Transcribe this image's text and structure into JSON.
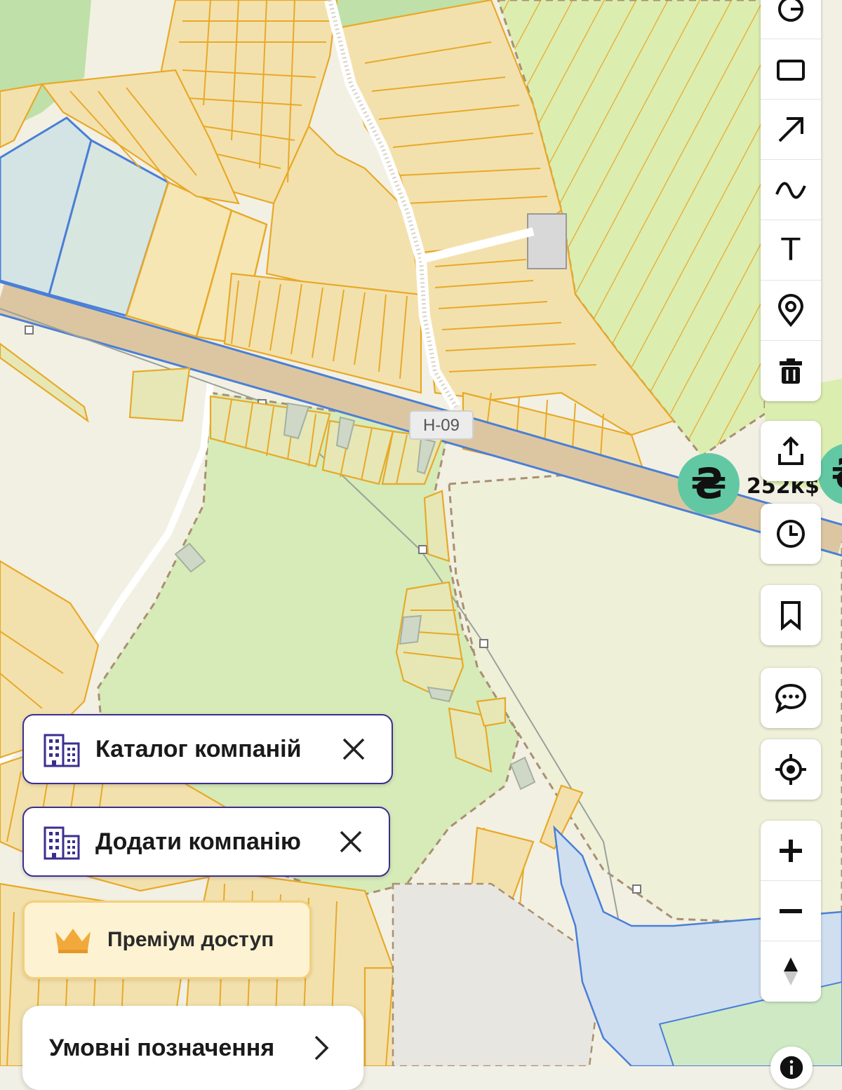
{
  "map": {
    "road_label": "Н-09",
    "price_marker": {
      "symbol": "₴",
      "label": "252к$"
    }
  },
  "toolbar": {
    "tools": [
      {
        "name": "circle-tool",
        "icon": "circle-icon"
      },
      {
        "name": "rectangle-tool",
        "icon": "rectangle-icon"
      },
      {
        "name": "arrow-tool",
        "icon": "arrow-icon"
      },
      {
        "name": "freehand-tool",
        "icon": "wave-icon"
      },
      {
        "name": "text-tool",
        "icon": "text-icon",
        "glyph": "T"
      },
      {
        "name": "marker-tool",
        "icon": "pin-icon"
      },
      {
        "name": "delete-tool",
        "icon": "trash-icon"
      }
    ],
    "share": {
      "icon": "share-icon"
    },
    "history": {
      "icon": "clock-icon"
    },
    "bookmark": {
      "icon": "bookmark-icon"
    },
    "comments": {
      "icon": "chat-icon"
    },
    "locate": {
      "icon": "locate-icon"
    },
    "zoom_in": {
      "icon": "plus-icon"
    },
    "zoom_out": {
      "icon": "minus-icon"
    },
    "compass": {
      "icon": "compass-icon"
    }
  },
  "panels": {
    "catalog": {
      "label": "Каталог компаній",
      "icon": "building-icon"
    },
    "add_company": {
      "label": "Додати компанію",
      "icon": "building-icon"
    },
    "premium": {
      "label": "Преміум доступ",
      "icon": "crown-icon"
    },
    "legend": {
      "label": "Умовні позначення",
      "icon": "chevron-right-icon"
    }
  },
  "colors": {
    "parcel_outline": "#e8a928",
    "parcel_fill": "#f6e6b3",
    "field_green": "#dcedbb",
    "meadow_green": "#d3ebb4",
    "water_blue": "#cfe0ee",
    "road_tan": "#dcc6a2",
    "brand_purple": "#3a2f8f",
    "badge_green": "#62c8a4",
    "premium_bg": "#fdf3d3"
  }
}
